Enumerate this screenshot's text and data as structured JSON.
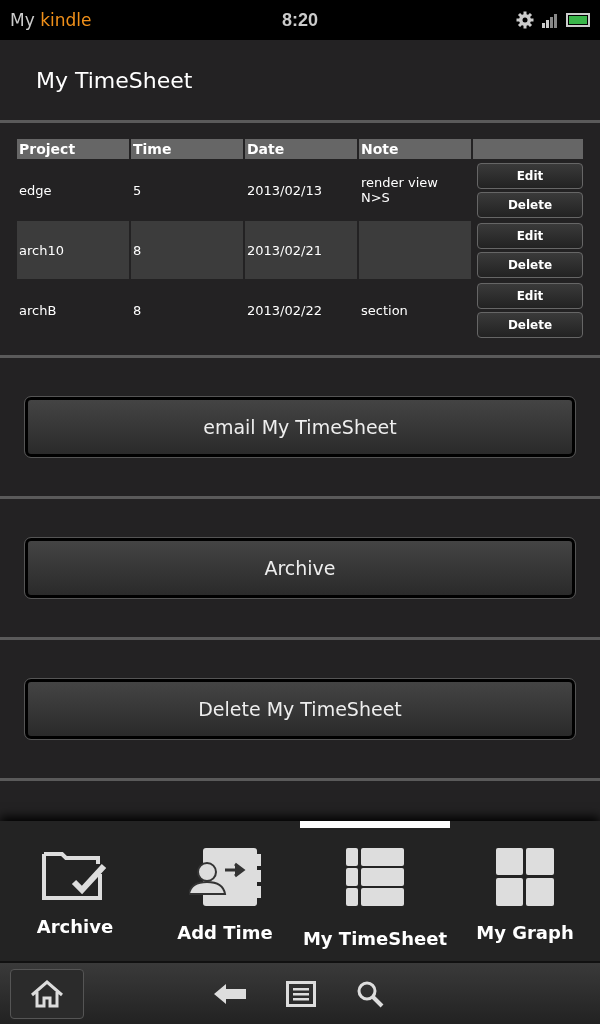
{
  "status_bar": {
    "brand_prefix": "My",
    "brand_name": "kindle",
    "time": "8:20"
  },
  "header": {
    "title": "My TimeSheet"
  },
  "table": {
    "columns": [
      "Project",
      "Time",
      "Date",
      "Note"
    ],
    "rows": [
      {
        "project": "edge",
        "time": "5",
        "date": "2013/02/13",
        "note": "render view N>S",
        "selected": false,
        "actions": [
          "Edit",
          "Delete"
        ]
      },
      {
        "project": "arch10",
        "time": "8",
        "date": "2013/02/21",
        "note": "",
        "selected": true,
        "actions": [
          "Edit",
          "Delete"
        ]
      },
      {
        "project": "archB",
        "time": "8",
        "date": "2013/02/22",
        "note": "section",
        "selected": false,
        "actions": [
          "Edit",
          "Delete"
        ]
      }
    ]
  },
  "buttons": [
    "email My TimeSheet",
    "Archive",
    "Delete My TimeSheet"
  ],
  "tabs": [
    {
      "label": "Archive",
      "kind": "folder",
      "selected": false
    },
    {
      "label": "Add Time",
      "kind": "contact",
      "selected": false
    },
    {
      "label": "My TimeSheet",
      "kind": "list",
      "selected": true
    },
    {
      "label": "My Graph",
      "kind": "grid",
      "selected": false
    }
  ]
}
